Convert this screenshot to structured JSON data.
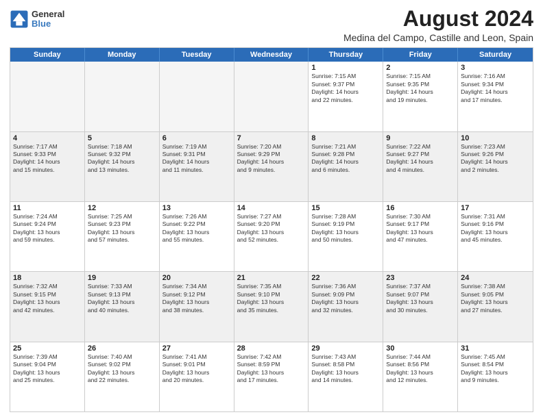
{
  "header": {
    "logo_general": "General",
    "logo_blue": "Blue",
    "month_year": "August 2024",
    "location": "Medina del Campo, Castille and Leon, Spain"
  },
  "days_of_week": [
    "Sunday",
    "Monday",
    "Tuesday",
    "Wednesday",
    "Thursday",
    "Friday",
    "Saturday"
  ],
  "weeks": [
    [
      {
        "day": "",
        "empty": true
      },
      {
        "day": "",
        "empty": true
      },
      {
        "day": "",
        "empty": true
      },
      {
        "day": "",
        "empty": true
      },
      {
        "day": "1",
        "lines": [
          "Sunrise: 7:15 AM",
          "Sunset: 9:37 PM",
          "Daylight: 14 hours",
          "and 22 minutes."
        ]
      },
      {
        "day": "2",
        "lines": [
          "Sunrise: 7:15 AM",
          "Sunset: 9:35 PM",
          "Daylight: 14 hours",
          "and 19 minutes."
        ]
      },
      {
        "day": "3",
        "lines": [
          "Sunrise: 7:16 AM",
          "Sunset: 9:34 PM",
          "Daylight: 14 hours",
          "and 17 minutes."
        ]
      }
    ],
    [
      {
        "day": "4",
        "lines": [
          "Sunrise: 7:17 AM",
          "Sunset: 9:33 PM",
          "Daylight: 14 hours",
          "and 15 minutes."
        ]
      },
      {
        "day": "5",
        "lines": [
          "Sunrise: 7:18 AM",
          "Sunset: 9:32 PM",
          "Daylight: 14 hours",
          "and 13 minutes."
        ]
      },
      {
        "day": "6",
        "lines": [
          "Sunrise: 7:19 AM",
          "Sunset: 9:31 PM",
          "Daylight: 14 hours",
          "and 11 minutes."
        ]
      },
      {
        "day": "7",
        "lines": [
          "Sunrise: 7:20 AM",
          "Sunset: 9:29 PM",
          "Daylight: 14 hours",
          "and 9 minutes."
        ]
      },
      {
        "day": "8",
        "lines": [
          "Sunrise: 7:21 AM",
          "Sunset: 9:28 PM",
          "Daylight: 14 hours",
          "and 6 minutes."
        ]
      },
      {
        "day": "9",
        "lines": [
          "Sunrise: 7:22 AM",
          "Sunset: 9:27 PM",
          "Daylight: 14 hours",
          "and 4 minutes."
        ]
      },
      {
        "day": "10",
        "lines": [
          "Sunrise: 7:23 AM",
          "Sunset: 9:26 PM",
          "Daylight: 14 hours",
          "and 2 minutes."
        ]
      }
    ],
    [
      {
        "day": "11",
        "lines": [
          "Sunrise: 7:24 AM",
          "Sunset: 9:24 PM",
          "Daylight: 13 hours",
          "and 59 minutes."
        ]
      },
      {
        "day": "12",
        "lines": [
          "Sunrise: 7:25 AM",
          "Sunset: 9:23 PM",
          "Daylight: 13 hours",
          "and 57 minutes."
        ]
      },
      {
        "day": "13",
        "lines": [
          "Sunrise: 7:26 AM",
          "Sunset: 9:22 PM",
          "Daylight: 13 hours",
          "and 55 minutes."
        ]
      },
      {
        "day": "14",
        "lines": [
          "Sunrise: 7:27 AM",
          "Sunset: 9:20 PM",
          "Daylight: 13 hours",
          "and 52 minutes."
        ]
      },
      {
        "day": "15",
        "lines": [
          "Sunrise: 7:28 AM",
          "Sunset: 9:19 PM",
          "Daylight: 13 hours",
          "and 50 minutes."
        ]
      },
      {
        "day": "16",
        "lines": [
          "Sunrise: 7:30 AM",
          "Sunset: 9:17 PM",
          "Daylight: 13 hours",
          "and 47 minutes."
        ]
      },
      {
        "day": "17",
        "lines": [
          "Sunrise: 7:31 AM",
          "Sunset: 9:16 PM",
          "Daylight: 13 hours",
          "and 45 minutes."
        ]
      }
    ],
    [
      {
        "day": "18",
        "lines": [
          "Sunrise: 7:32 AM",
          "Sunset: 9:15 PM",
          "Daylight: 13 hours",
          "and 42 minutes."
        ]
      },
      {
        "day": "19",
        "lines": [
          "Sunrise: 7:33 AM",
          "Sunset: 9:13 PM",
          "Daylight: 13 hours",
          "and 40 minutes."
        ]
      },
      {
        "day": "20",
        "lines": [
          "Sunrise: 7:34 AM",
          "Sunset: 9:12 PM",
          "Daylight: 13 hours",
          "and 38 minutes."
        ]
      },
      {
        "day": "21",
        "lines": [
          "Sunrise: 7:35 AM",
          "Sunset: 9:10 PM",
          "Daylight: 13 hours",
          "and 35 minutes."
        ]
      },
      {
        "day": "22",
        "lines": [
          "Sunrise: 7:36 AM",
          "Sunset: 9:09 PM",
          "Daylight: 13 hours",
          "and 32 minutes."
        ]
      },
      {
        "day": "23",
        "lines": [
          "Sunrise: 7:37 AM",
          "Sunset: 9:07 PM",
          "Daylight: 13 hours",
          "and 30 minutes."
        ]
      },
      {
        "day": "24",
        "lines": [
          "Sunrise: 7:38 AM",
          "Sunset: 9:05 PM",
          "Daylight: 13 hours",
          "and 27 minutes."
        ]
      }
    ],
    [
      {
        "day": "25",
        "lines": [
          "Sunrise: 7:39 AM",
          "Sunset: 9:04 PM",
          "Daylight: 13 hours",
          "and 25 minutes."
        ]
      },
      {
        "day": "26",
        "lines": [
          "Sunrise: 7:40 AM",
          "Sunset: 9:02 PM",
          "Daylight: 13 hours",
          "and 22 minutes."
        ]
      },
      {
        "day": "27",
        "lines": [
          "Sunrise: 7:41 AM",
          "Sunset: 9:01 PM",
          "Daylight: 13 hours",
          "and 20 minutes."
        ]
      },
      {
        "day": "28",
        "lines": [
          "Sunrise: 7:42 AM",
          "Sunset: 8:59 PM",
          "Daylight: 13 hours",
          "and 17 minutes."
        ]
      },
      {
        "day": "29",
        "lines": [
          "Sunrise: 7:43 AM",
          "Sunset: 8:58 PM",
          "Daylight: 13 hours",
          "and 14 minutes."
        ]
      },
      {
        "day": "30",
        "lines": [
          "Sunrise: 7:44 AM",
          "Sunset: 8:56 PM",
          "Daylight: 13 hours",
          "and 12 minutes."
        ]
      },
      {
        "day": "31",
        "lines": [
          "Sunrise: 7:45 AM",
          "Sunset: 8:54 PM",
          "Daylight: 13 hours",
          "and 9 minutes."
        ]
      }
    ]
  ]
}
